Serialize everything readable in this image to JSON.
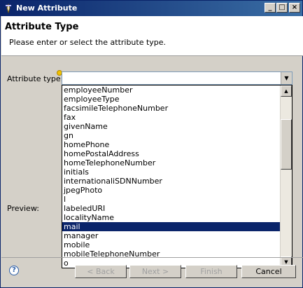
{
  "window": {
    "title": "New Attribute"
  },
  "header": {
    "title": "Attribute Type",
    "description": "Please enter or select the attribute type."
  },
  "form": {
    "attribute_type_label": "Attribute type:",
    "attribute_type_value": "",
    "preview_label": "Preview:"
  },
  "dropdown": {
    "items": [
      "employeeNumber",
      "employeeType",
      "facsimileTelephoneNumber",
      "fax",
      "givenName",
      "gn",
      "homePhone",
      "homePostalAddress",
      "homeTelephoneNumber",
      "initials",
      "internationaliSDNNumber",
      "jpegPhoto",
      "l",
      "labeledURI",
      "localityName",
      "mail",
      "manager",
      "mobile",
      "mobileTelephoneNumber",
      "o"
    ],
    "selected": "mail"
  },
  "footer": {
    "back": "< Back",
    "next": "Next >",
    "finish": "Finish",
    "cancel": "Cancel"
  },
  "colors": {
    "title_bar": "#0a246a",
    "selection": "#0a246a",
    "face": "#d4d0c8"
  }
}
